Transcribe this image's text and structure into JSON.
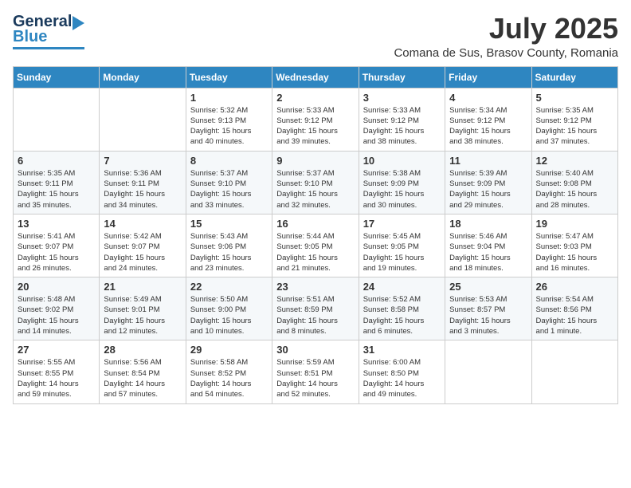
{
  "header": {
    "logo_general": "General",
    "logo_blue": "Blue",
    "month": "July 2025",
    "location": "Comana de Sus, Brasov County, Romania"
  },
  "days_of_week": [
    "Sunday",
    "Monday",
    "Tuesday",
    "Wednesday",
    "Thursday",
    "Friday",
    "Saturday"
  ],
  "weeks": [
    [
      {
        "day": "",
        "info": ""
      },
      {
        "day": "",
        "info": ""
      },
      {
        "day": "1",
        "info": "Sunrise: 5:32 AM\nSunset: 9:13 PM\nDaylight: 15 hours\nand 40 minutes."
      },
      {
        "day": "2",
        "info": "Sunrise: 5:33 AM\nSunset: 9:12 PM\nDaylight: 15 hours\nand 39 minutes."
      },
      {
        "day": "3",
        "info": "Sunrise: 5:33 AM\nSunset: 9:12 PM\nDaylight: 15 hours\nand 38 minutes."
      },
      {
        "day": "4",
        "info": "Sunrise: 5:34 AM\nSunset: 9:12 PM\nDaylight: 15 hours\nand 38 minutes."
      },
      {
        "day": "5",
        "info": "Sunrise: 5:35 AM\nSunset: 9:12 PM\nDaylight: 15 hours\nand 37 minutes."
      }
    ],
    [
      {
        "day": "6",
        "info": "Sunrise: 5:35 AM\nSunset: 9:11 PM\nDaylight: 15 hours\nand 35 minutes."
      },
      {
        "day": "7",
        "info": "Sunrise: 5:36 AM\nSunset: 9:11 PM\nDaylight: 15 hours\nand 34 minutes."
      },
      {
        "day": "8",
        "info": "Sunrise: 5:37 AM\nSunset: 9:10 PM\nDaylight: 15 hours\nand 33 minutes."
      },
      {
        "day": "9",
        "info": "Sunrise: 5:37 AM\nSunset: 9:10 PM\nDaylight: 15 hours\nand 32 minutes."
      },
      {
        "day": "10",
        "info": "Sunrise: 5:38 AM\nSunset: 9:09 PM\nDaylight: 15 hours\nand 30 minutes."
      },
      {
        "day": "11",
        "info": "Sunrise: 5:39 AM\nSunset: 9:09 PM\nDaylight: 15 hours\nand 29 minutes."
      },
      {
        "day": "12",
        "info": "Sunrise: 5:40 AM\nSunset: 9:08 PM\nDaylight: 15 hours\nand 28 minutes."
      }
    ],
    [
      {
        "day": "13",
        "info": "Sunrise: 5:41 AM\nSunset: 9:07 PM\nDaylight: 15 hours\nand 26 minutes."
      },
      {
        "day": "14",
        "info": "Sunrise: 5:42 AM\nSunset: 9:07 PM\nDaylight: 15 hours\nand 24 minutes."
      },
      {
        "day": "15",
        "info": "Sunrise: 5:43 AM\nSunset: 9:06 PM\nDaylight: 15 hours\nand 23 minutes."
      },
      {
        "day": "16",
        "info": "Sunrise: 5:44 AM\nSunset: 9:05 PM\nDaylight: 15 hours\nand 21 minutes."
      },
      {
        "day": "17",
        "info": "Sunrise: 5:45 AM\nSunset: 9:05 PM\nDaylight: 15 hours\nand 19 minutes."
      },
      {
        "day": "18",
        "info": "Sunrise: 5:46 AM\nSunset: 9:04 PM\nDaylight: 15 hours\nand 18 minutes."
      },
      {
        "day": "19",
        "info": "Sunrise: 5:47 AM\nSunset: 9:03 PM\nDaylight: 15 hours\nand 16 minutes."
      }
    ],
    [
      {
        "day": "20",
        "info": "Sunrise: 5:48 AM\nSunset: 9:02 PM\nDaylight: 15 hours\nand 14 minutes."
      },
      {
        "day": "21",
        "info": "Sunrise: 5:49 AM\nSunset: 9:01 PM\nDaylight: 15 hours\nand 12 minutes."
      },
      {
        "day": "22",
        "info": "Sunrise: 5:50 AM\nSunset: 9:00 PM\nDaylight: 15 hours\nand 10 minutes."
      },
      {
        "day": "23",
        "info": "Sunrise: 5:51 AM\nSunset: 8:59 PM\nDaylight: 15 hours\nand 8 minutes."
      },
      {
        "day": "24",
        "info": "Sunrise: 5:52 AM\nSunset: 8:58 PM\nDaylight: 15 hours\nand 6 minutes."
      },
      {
        "day": "25",
        "info": "Sunrise: 5:53 AM\nSunset: 8:57 PM\nDaylight: 15 hours\nand 3 minutes."
      },
      {
        "day": "26",
        "info": "Sunrise: 5:54 AM\nSunset: 8:56 PM\nDaylight: 15 hours\nand 1 minute."
      }
    ],
    [
      {
        "day": "27",
        "info": "Sunrise: 5:55 AM\nSunset: 8:55 PM\nDaylight: 14 hours\nand 59 minutes."
      },
      {
        "day": "28",
        "info": "Sunrise: 5:56 AM\nSunset: 8:54 PM\nDaylight: 14 hours\nand 57 minutes."
      },
      {
        "day": "29",
        "info": "Sunrise: 5:58 AM\nSunset: 8:52 PM\nDaylight: 14 hours\nand 54 minutes."
      },
      {
        "day": "30",
        "info": "Sunrise: 5:59 AM\nSunset: 8:51 PM\nDaylight: 14 hours\nand 52 minutes."
      },
      {
        "day": "31",
        "info": "Sunrise: 6:00 AM\nSunset: 8:50 PM\nDaylight: 14 hours\nand 49 minutes."
      },
      {
        "day": "",
        "info": ""
      },
      {
        "day": "",
        "info": ""
      }
    ]
  ]
}
